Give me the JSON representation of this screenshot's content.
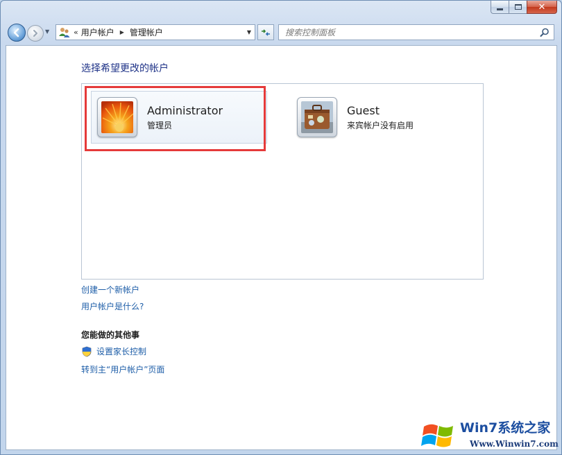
{
  "navigation": {
    "breadcrumb_overflow": "«",
    "breadcrumbs": [
      "用户帐户",
      "管理帐户"
    ]
  },
  "search": {
    "placeholder": "搜索控制面板"
  },
  "main": {
    "title": "选择希望更改的帐户",
    "accounts": [
      {
        "name": "Administrator",
        "role": "管理员",
        "selected": true
      },
      {
        "name": "Guest",
        "role": "来宾帐户没有启用",
        "selected": false
      }
    ],
    "links": {
      "create": "创建一个新帐户",
      "what": "用户帐户是什么?"
    },
    "other_section": {
      "heading": "您能做的其他事",
      "parental": "设置家长控制",
      "goto_main": "转到主“用户帐户”页面"
    }
  },
  "watermark": {
    "brand": "Win7系统之家",
    "url": "Www.Winwin7.com"
  },
  "colors": {
    "link": "#1e5ea8",
    "title": "#1e3287",
    "highlight": "#e53a3a"
  }
}
